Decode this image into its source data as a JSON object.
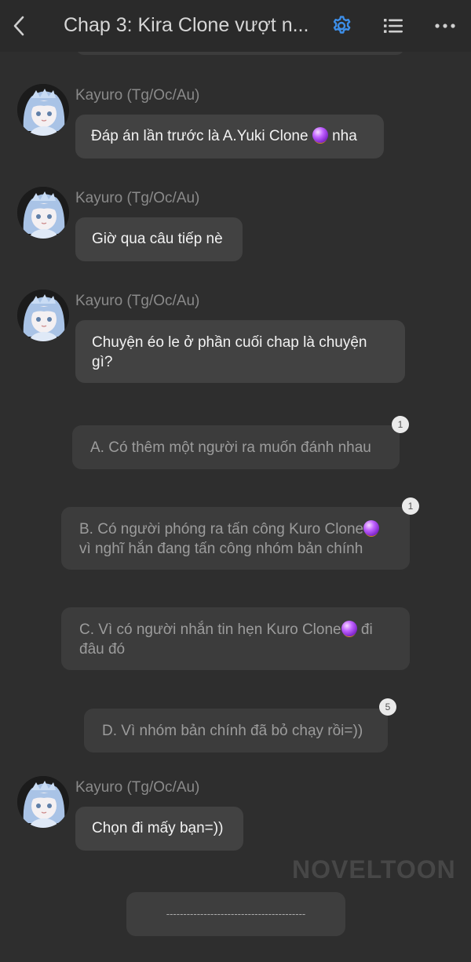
{
  "header": {
    "title": "Chap 3: Kira Clone vượt n...",
    "back_icon": "chevron-left-icon",
    "settings_icon": "gear-icon",
    "list_icon": "list-icon",
    "more_icon": "more-icon",
    "accent_color": "#3d8ee8"
  },
  "messages": [
    {
      "author": "Kayuro (Tg/Oc/Au)",
      "text_before": "Đáp án lần trước là A.Yuki Clone ",
      "icon": "crystal-ball-icon",
      "text_after": " nha"
    },
    {
      "author": "Kayuro (Tg/Oc/Au)",
      "text": "Giờ qua câu tiếp nè"
    },
    {
      "author": "Kayuro (Tg/Oc/Au)",
      "text": "Chuyện éo le ở phần cuối chap là chuyện gì?"
    }
  ],
  "options": [
    {
      "text": "A. Có thêm một người ra muốn đánh nhau",
      "count": "1"
    },
    {
      "text_before": "B. Có người phóng ra tấn công Kuro Clone",
      "icon": "crystal-ball-icon",
      "text_after": " vì nghĩ hắn đang tấn công nhóm bản chính",
      "count": "1"
    },
    {
      "text_before": "C. Vì có người nhắn tin hẹn Kuro Clone",
      "icon": "crystal-ball-icon",
      "text_after": " đi đâu đó"
    },
    {
      "text": "D. Vì nhóm bản chính đã bỏ chạy rồi=))",
      "count": "5"
    }
  ],
  "final_message": {
    "author": "Kayuro (Tg/Oc/Au)",
    "text": "Chọn đi mấy bạn=))"
  },
  "watermark": "NOVELTOON",
  "end_divider": "-----------------------------------------"
}
